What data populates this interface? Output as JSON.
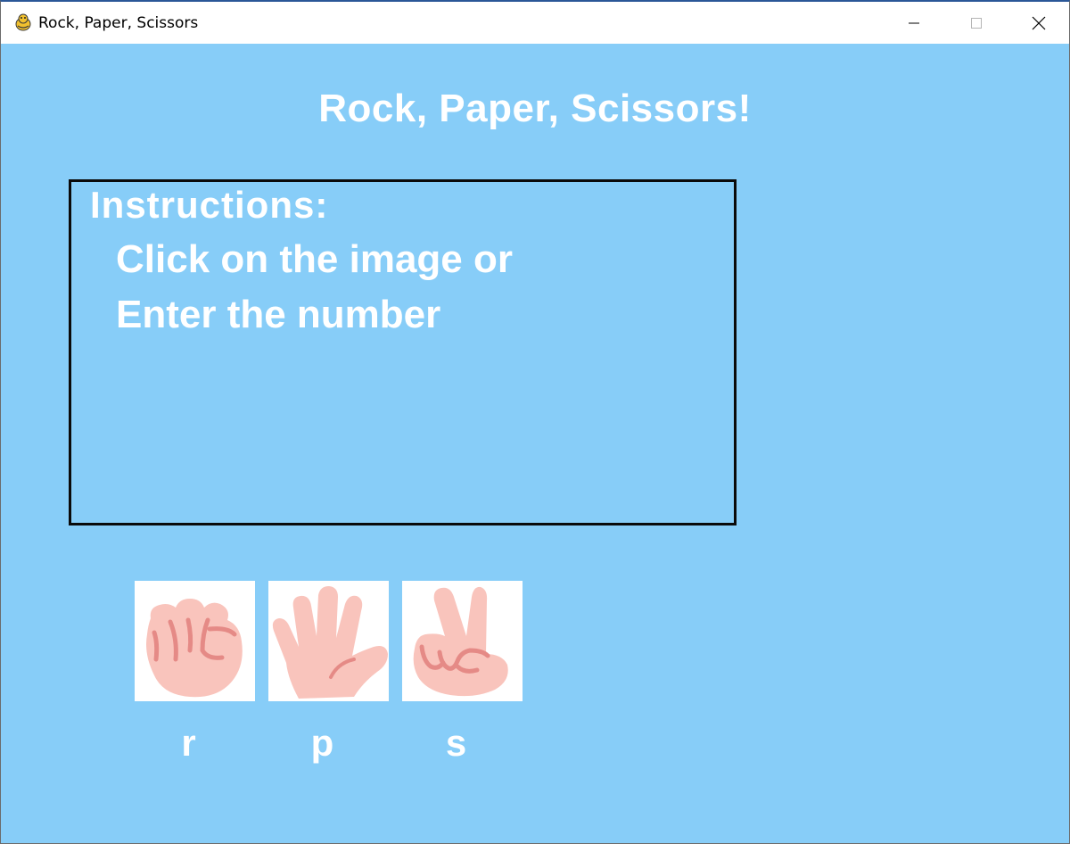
{
  "window": {
    "title": "Rock, Paper, Scissors"
  },
  "titlebar_icons": {
    "app": "pygame-snake-icon",
    "minimize": "minimize-icon",
    "maximize": "maximize-icon",
    "close": "close-icon"
  },
  "game": {
    "title": "Rock, Paper, Scissors!",
    "background_color": "#87cdf8",
    "text_color": "#ffffff"
  },
  "instructions": {
    "heading": "Instructions:",
    "line1": "Click on the image or",
    "line2": "Enter the number"
  },
  "choices": [
    {
      "name": "rock",
      "icon": "rock-fist-icon",
      "key": "r"
    },
    {
      "name": "paper",
      "icon": "paper-hand-icon",
      "key": "p"
    },
    {
      "name": "scissors",
      "icon": "scissors-hand-icon",
      "key": "s"
    }
  ],
  "colors": {
    "skin": "#f9c4bc",
    "skin_lines": "#e58a86"
  }
}
